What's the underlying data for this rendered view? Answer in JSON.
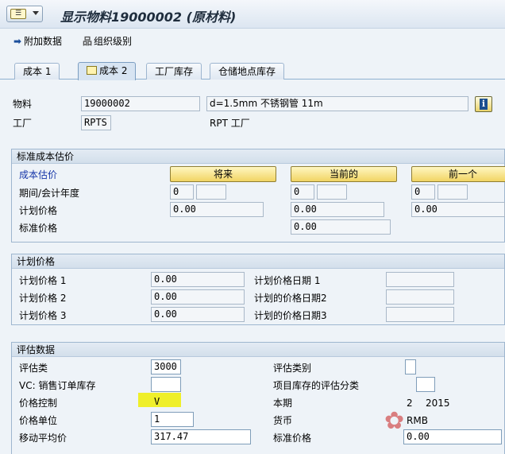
{
  "title": "显示物料19000002 (原材料)",
  "toolbar": {
    "additional_data": "附加数据",
    "org_levels": "组织级别"
  },
  "tabs": [
    "成本 1",
    "成本 2",
    "工厂库存",
    "仓储地点库存"
  ],
  "active_tab": "成本 2",
  "header": {
    "material_label": "物料",
    "material_value": "19000002",
    "material_desc": "d=1.5mm 不锈钢管 11m",
    "plant_label": "工厂",
    "plant_value": "RPTS",
    "plant_desc": "RPT 工厂"
  },
  "std_cost": {
    "section_title": "标准成本估价",
    "estimate_label": "成本估价",
    "btn_future": "将来",
    "btn_current": "当前的",
    "btn_previous": "前一个",
    "period_label": "期间/会计年度",
    "future_period": "0",
    "current_period": "0",
    "previous_period": "0",
    "planned_price_label": "计划价格",
    "future_planned_price": "0.00",
    "current_planned_price": "0.00",
    "previous_planned_price": "0.00",
    "standard_price_label": "标准价格",
    "current_standard_price": "0.00"
  },
  "planned_prices": {
    "section_title": "计划价格",
    "rows": [
      {
        "label": "计划价格 1",
        "value": "0.00",
        "date_label": "计划价格日期 1"
      },
      {
        "label": "计划价格 2",
        "value": "0.00",
        "date_label": "计划的价格日期2"
      },
      {
        "label": "计划价格 3",
        "value": "0.00",
        "date_label": "计划的价格日期3"
      }
    ]
  },
  "valuation": {
    "section_title": "评估数据",
    "valuation_class_label": "评估类",
    "valuation_class": "3000",
    "valuation_category_label": "评估类别",
    "vc_sales_label": "VC: 销售订单库存",
    "proj_stock_label": "项目库存的评估分类",
    "price_control_label": "价格控制",
    "price_control": "V",
    "current_period_label": "本期",
    "current_period_value": "2",
    "current_year_value": "2015",
    "price_unit_label": "价格单位",
    "price_unit": "1",
    "currency_label": "货币",
    "currency": "RMB",
    "mov_avg_label": "移动平均价",
    "mov_avg_price": "317.47",
    "std_price_label": "标准价格",
    "std_price": "0.00"
  },
  "colors": {
    "accent_yellow": "#f1d463",
    "highlight": "#efef2a",
    "link_blue": "#1636a8"
  }
}
